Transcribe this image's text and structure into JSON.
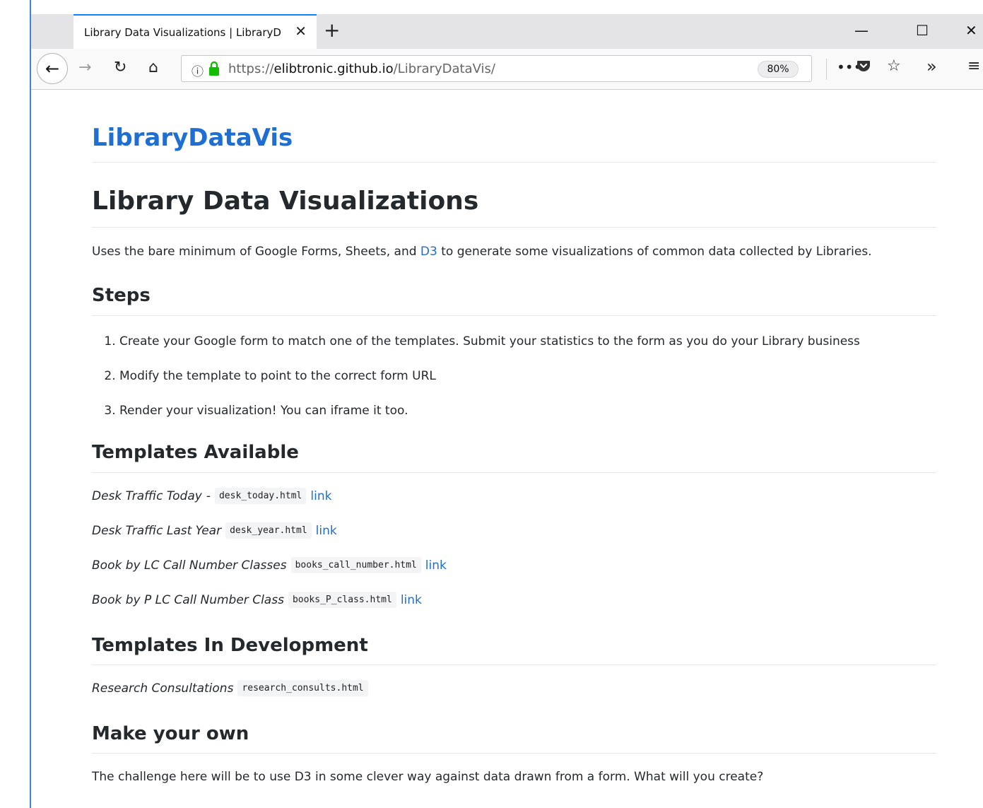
{
  "browser": {
    "tab_title": "Library Data Visualizations | LibraryD",
    "tab_close": "✕",
    "new_tab": "+",
    "minimize": "—",
    "maximize": "☐",
    "close_window": "✕",
    "url_scheme": "https://",
    "url_host": "elibtronic.github.io",
    "url_path": "/LibraryDataVis/",
    "zoom": "80%",
    "icons": [
      "back-arrow-icon",
      "forward-arrow-icon",
      "reload-icon",
      "home-icon",
      "info-icon",
      "lock-icon",
      "page-actions-icon",
      "pocket-icon",
      "bookmark-star-icon",
      "overflow-chevron-icon",
      "hamburger-menu-icon"
    ]
  },
  "page": {
    "site_title": "LibraryDataVis",
    "h1": "Library Data Visualizations",
    "intro_before": "Uses the bare minimum of Google Forms, Sheets, and ",
    "intro_link": "D3",
    "intro_after": " to generate some visualizations of common data collected by Libraries.",
    "steps_heading": "Steps",
    "steps": [
      "Create your Google form to match one of the templates. Submit your statistics to the form as you do your Library business",
      "Modify the template to point to the correct form URL",
      "Render your visualization! You can iframe it too."
    ],
    "templates_heading": "Templates Available",
    "templates": [
      {
        "name": "Desk Traffic Today",
        "sep": "-",
        "file": "desk_today.html",
        "link": "link"
      },
      {
        "name": "Desk Traffic Last Year",
        "sep": "",
        "file": "desk_year.html",
        "link": "link"
      },
      {
        "name": "Book by LC Call Number Classes",
        "sep": "",
        "file": "books_call_number.html",
        "link": "link"
      },
      {
        "name": "Book by P LC Call Number Class",
        "sep": "",
        "file": "books_P_class.html",
        "link": "link"
      }
    ],
    "dev_heading": "Templates In Development",
    "dev_templates": [
      {
        "name": "Research Consultations",
        "file": "research_consults.html"
      }
    ],
    "own_heading": "Make your own",
    "own_text": "The challenge here will be to use D3 in some clever way against data drawn from a form. What will you create?"
  },
  "colors": {
    "link": "#1e6fd1",
    "tab_accent": "#0a84ff",
    "text": "#24292e",
    "lock": "#12bc00"
  }
}
